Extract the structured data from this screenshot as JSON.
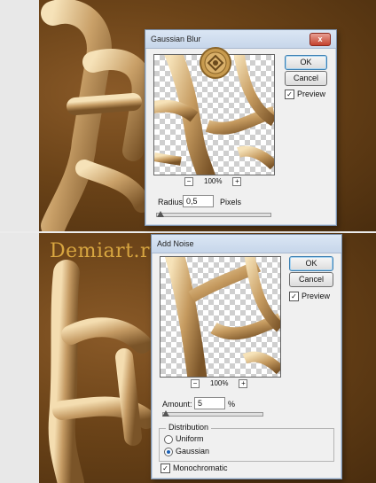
{
  "top_dialog": {
    "title": "Gaussian Blur",
    "close_symbol": "x",
    "ok_label": "OK",
    "cancel_label": "Cancel",
    "preview_checked": true,
    "preview_label": "Preview",
    "zoom_out_symbol": "−",
    "zoom_in_symbol": "+",
    "zoom_pct": "100%",
    "radius_label": "Radius:",
    "radius_value": "0,5",
    "radius_unit": "Pixels",
    "radius_slider_fraction": 0.02
  },
  "watermark": "Demiart.ru",
  "bottom_dialog": {
    "title": "Add Noise",
    "ok_label": "OK",
    "cancel_label": "Cancel",
    "preview_checked": true,
    "preview_label": "Preview",
    "zoom_out_symbol": "−",
    "zoom_in_symbol": "+",
    "zoom_pct": "100%",
    "amount_label": "Amount:",
    "amount_value": "5",
    "amount_unit": "%",
    "amount_slider_fraction": 0.02,
    "distribution_label": "Distribution",
    "uniform_label": "Uniform",
    "gaussian_label": "Gaussian",
    "selected_distribution": "Gaussian",
    "monochromatic_checked": true,
    "monochromatic_label": "Monochromatic"
  },
  "icons": {
    "check": "check-icon",
    "canvas_tile": "ornament-tile"
  }
}
